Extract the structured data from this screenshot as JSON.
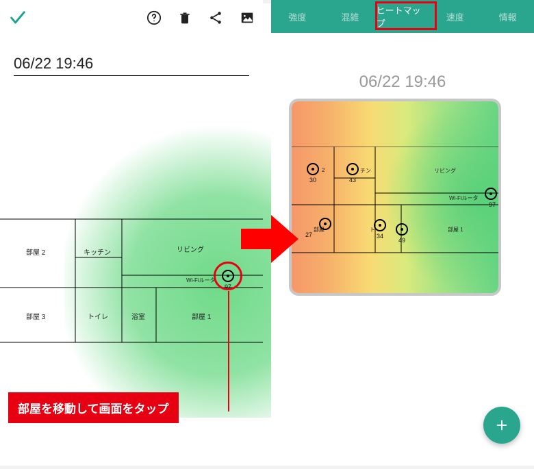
{
  "left": {
    "timestamp": "06/22 19:46",
    "rooms": {
      "room2": "部屋 2",
      "kitchen": "キッチン",
      "living": "リビング",
      "router": "Wi-Fiルータ",
      "room3": "部屋 3",
      "toilet": "トイレ",
      "bath": "浴室",
      "room1": "部屋 1"
    },
    "point_value": "97",
    "callout": "部屋を移動して画面をタップ"
  },
  "right": {
    "tabs": [
      "強度",
      "混雑",
      "ヒートマップ",
      "速度",
      "情報"
    ],
    "active_tab_index": 2,
    "timestamp": "06/22 19:46",
    "rooms": {
      "room2_frag": "2",
      "kitchen_frag": "チン",
      "living": "リビング",
      "router": "Wi-Fiルータ",
      "room_frag": "部屋",
      "toilet_frag": "ト",
      "room1": "部屋 1"
    },
    "points": [
      {
        "val": "30"
      },
      {
        "val": "43"
      },
      {
        "val": "97"
      },
      {
        "val": "27"
      },
      {
        "val": "34"
      },
      {
        "val": "49"
      }
    ]
  },
  "icons": {
    "check": "check-icon",
    "help": "help-icon",
    "delete": "delete-icon",
    "share": "share-icon",
    "image": "image-icon",
    "plus": "plus-icon"
  },
  "colors": {
    "teal": "#2aa68e",
    "red": "#e60012",
    "green_glow": "#60d67c"
  }
}
